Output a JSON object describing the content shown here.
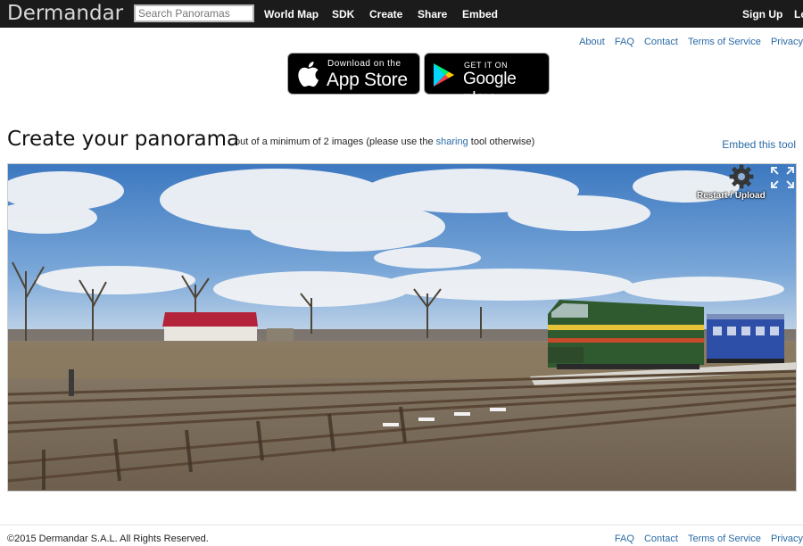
{
  "header": {
    "logo": "Dermandar",
    "search_placeholder": "Search Panoramas",
    "nav": [
      "World Map",
      "SDK",
      "Create",
      "Share",
      "Embed"
    ],
    "signup": "Sign Up",
    "login_partial": "Lo"
  },
  "top_links": [
    "About",
    "FAQ",
    "Contact",
    "Terms of Service",
    "Privacy"
  ],
  "badges": {
    "appstore_small": "Download on the",
    "appstore_big": "App Store",
    "googleplay_small": "GET IT ON",
    "googleplay_big": "Google play"
  },
  "main": {
    "title": "Create your panorama",
    "subtitle_before": "out of a minimum of 2 images (please use the",
    "subtitle_link": "sharing",
    "subtitle_after": "tool otherwise)",
    "embed_tool": "Embed this tool",
    "restart_upload": "Restart / Upload"
  },
  "footer": {
    "copyright": "©2015 Dermandar S.A.L. All Rights Reserved.",
    "links": [
      "FAQ",
      "Contact",
      "Terms of Service",
      "Privacy"
    ]
  },
  "colors": {
    "topbar": "#1b1b1b",
    "link": "#2a6aa6",
    "sky": "#4a86c8",
    "locomotive": "#2f5a2f",
    "carriage": "#2e4fa8"
  }
}
